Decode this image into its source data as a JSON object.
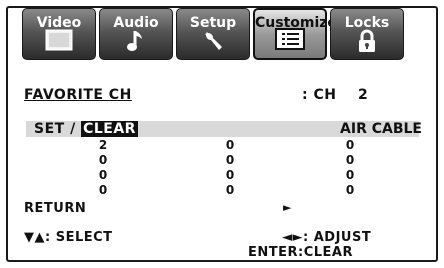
{
  "tabs": [
    {
      "label": "Video",
      "icon": "screen-icon",
      "active": false
    },
    {
      "label": "Audio",
      "icon": "music-note-icon",
      "active": false
    },
    {
      "label": "Setup",
      "icon": "wrench-icon",
      "active": false
    },
    {
      "label": "Customize",
      "icon": "list-icon",
      "active": true
    },
    {
      "label": "Locks",
      "icon": "padlock-icon",
      "active": false
    }
  ],
  "favorite": {
    "title": "FAVORITE CH",
    "ch_label": ": CH",
    "ch_value": "2"
  },
  "table": {
    "header_left": "SET /",
    "header_clear": "CLEAR",
    "header_right": "AIR CABLE",
    "rows": [
      [
        "2",
        "0",
        "0"
      ],
      [
        "0",
        "0",
        "0"
      ],
      [
        "0",
        "0",
        "0"
      ],
      [
        "0",
        "0",
        "0"
      ]
    ]
  },
  "return_label": "RETURN",
  "return_arrow": "►",
  "hints": {
    "select": "▼▲: SELECT",
    "adjust": "◄►: ADJUST",
    "clear": "ENTER:CLEAR"
  }
}
